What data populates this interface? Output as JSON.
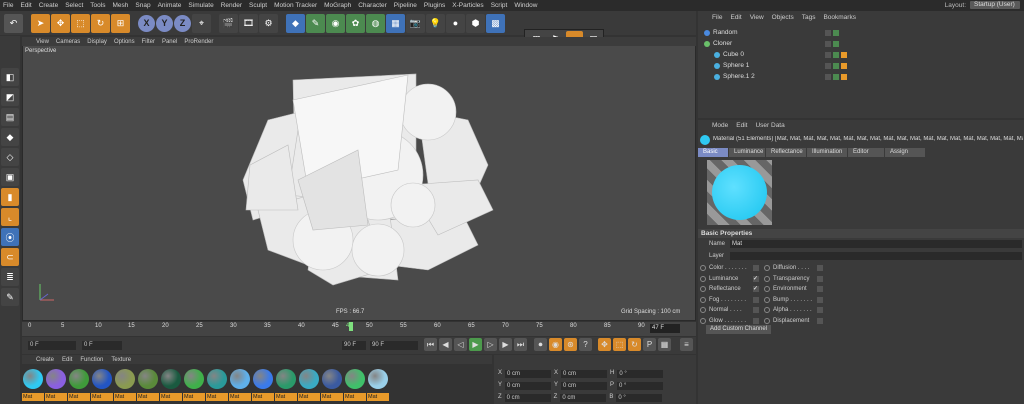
{
  "menu": [
    "File",
    "Edit",
    "Create",
    "Select",
    "Tools",
    "Mesh",
    "Snap",
    "Animate",
    "Simulate",
    "Render",
    "Sculpt",
    "Motion Tracker",
    "MoGraph",
    "Character",
    "Pipeline",
    "Plugins",
    "X-Particles",
    "Script",
    "Window"
  ],
  "layout": {
    "label": "Layout:",
    "value": "Startup (User)"
  },
  "toolbar": {
    "axis_x": "X",
    "axis_y": "Y",
    "axis_z": "Z"
  },
  "viewport": {
    "menu": [
      "View",
      "Cameras",
      "Display",
      "Options",
      "Filter",
      "Panel",
      "ProRender"
    ],
    "title": "Perspective",
    "fps": "FPS : 66.7",
    "grid": "Grid Spacing : 100 cm"
  },
  "timeline": {
    "ticks": [
      "0",
      "5",
      "10",
      "15",
      "20",
      "25",
      "30",
      "35",
      "40",
      "45",
      "47",
      "50",
      "55",
      "60",
      "65",
      "70",
      "75",
      "80",
      "85",
      "90"
    ],
    "current_field": "47 F",
    "start": "0 F",
    "offset": "0 F",
    "end": "90 F",
    "end2": "90 F"
  },
  "material_menu": [
    "Create",
    "Edit",
    "Function",
    "Texture"
  ],
  "materials": [
    {
      "label": "Mat",
      "color": "#2fc9f2"
    },
    {
      "label": "Mat",
      "color": "#8a5fe0"
    },
    {
      "label": "Mat",
      "color": "#3f9a3a"
    },
    {
      "label": "Mat",
      "color": "#2255c4"
    },
    {
      "label": "Mat",
      "color": "#8a9a50"
    },
    {
      "label": "Mat",
      "color": "#5a8a3a"
    },
    {
      "label": "Mat",
      "color": "#1a5a40"
    },
    {
      "label": "Mat",
      "color": "#3fb04a"
    },
    {
      "label": "Mat",
      "color": "#2a9a9a"
    },
    {
      "label": "Mat",
      "color": "#5fb0ea"
    },
    {
      "label": "Mat",
      "color": "#3a7aea"
    },
    {
      "label": "Mat",
      "color": "#2a9a6a"
    },
    {
      "label": "Mat",
      "color": "#3aaac4"
    },
    {
      "label": "Mat",
      "color": "#3a5aa0"
    },
    {
      "label": "Mat",
      "color": "#3fc06a"
    },
    {
      "label": "Mat",
      "color": "#9ad0ea"
    }
  ],
  "coords": {
    "x": "X",
    "y": "Y",
    "z": "Z",
    "pos_x": "0 cm",
    "pos_y": "0 cm",
    "pos_z": "0 cm",
    "size_x": "0 cm",
    "size_y": "0 cm",
    "size_z": "0 cm",
    "h": "H",
    "p": "P",
    "b": "B",
    "rot_h": "0 °",
    "rot_p": "0 °",
    "rot_b": "0 °"
  },
  "object_manager": {
    "menu": [
      "File",
      "Edit",
      "View",
      "Objects",
      "Tags",
      "Bookmarks"
    ],
    "objects": [
      {
        "name": "Random",
        "color": "#4a8ae0"
      },
      {
        "name": "Cloner",
        "color": "#6ac06a"
      },
      {
        "name": "Cube 0",
        "color": "#4ab0e0"
      },
      {
        "name": "Sphere 1",
        "color": "#4ab0e0"
      },
      {
        "name": "Sphere.1 2",
        "color": "#4ab0e0"
      }
    ]
  },
  "attributes": {
    "menu": [
      "Mode",
      "Edit",
      "User Data"
    ],
    "title": "Material (51 Elements) [Mat, Mat, Mat, Mat, Mat, Mat, Mat, Mat, Mat, Mat, Mat, Mat, Mat, Mat, Mat, Mat, Mat, Mat, Mat, Mat",
    "tabs": [
      "Basic",
      "Luminance",
      "Reflectance",
      "Illumination",
      "Editor",
      "Assign"
    ],
    "section": "Basic Properties",
    "name_label": "Name",
    "name_value": "Mat",
    "layer_label": "Layer",
    "props_left": [
      {
        "label": "Color . . . . . . .",
        "checked": ""
      },
      {
        "label": "Luminance",
        "checked": "✓"
      },
      {
        "label": "Reflectance",
        "checked": "✓"
      },
      {
        "label": "Fog . . . . . . . .",
        "checked": ""
      },
      {
        "label": "Normal . . . .",
        "checked": ""
      },
      {
        "label": "Glow . . . . . . .",
        "checked": ""
      }
    ],
    "props_right": [
      {
        "label": "Diffusion . . . .",
        "checked": ""
      },
      {
        "label": "Transparency",
        "checked": ""
      },
      {
        "label": "Environment",
        "checked": ""
      },
      {
        "label": "Bump . . . . . . .",
        "checked": ""
      },
      {
        "label": "Alpha . . . . . . .",
        "checked": ""
      },
      {
        "label": "Displacement",
        "checked": ""
      }
    ],
    "add_channel": "Add Custom Channel"
  }
}
